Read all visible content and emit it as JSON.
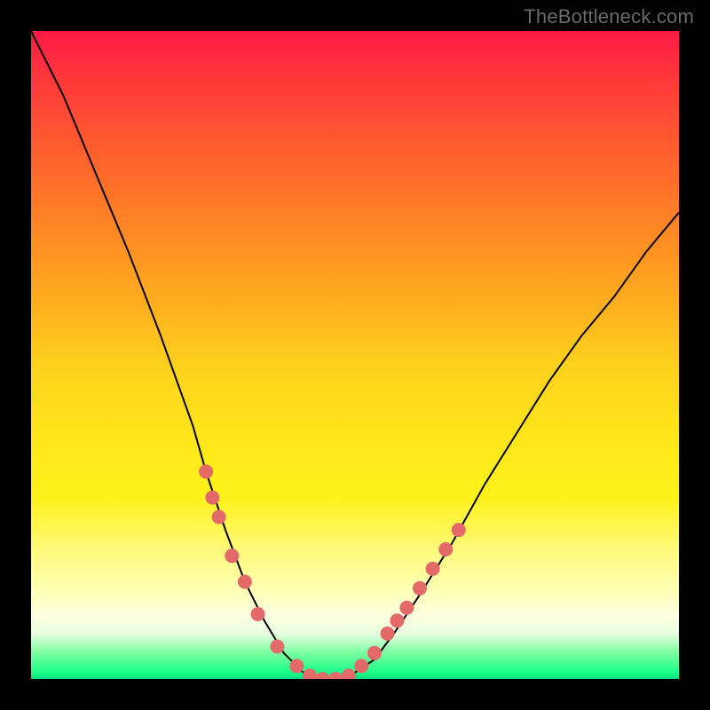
{
  "watermark": "TheBottleneck.com",
  "colors": {
    "black": "#000000",
    "dot": "#e46a6a",
    "gradient_top": "#ff1a44",
    "gradient_bottom": "#0bdf81"
  },
  "chart_data": {
    "type": "line",
    "title": "",
    "xlabel": "",
    "ylabel": "",
    "xlim": [
      0,
      100
    ],
    "ylim": [
      0,
      100
    ],
    "grid": false,
    "legend": false,
    "annotations": [
      "TheBottleneck.com"
    ],
    "series": [
      {
        "name": "bottleneck-curve",
        "x": [
          0,
          5,
          10,
          15,
          20,
          25,
          27,
          30,
          33,
          36,
          39,
          42,
          44,
          46,
          48,
          50,
          53,
          56,
          60,
          65,
          70,
          75,
          80,
          85,
          90,
          95,
          100
        ],
        "y": [
          100,
          90,
          78,
          66,
          53,
          39,
          32,
          23,
          15,
          9,
          4,
          1,
          0,
          0,
          0,
          1,
          3,
          7,
          13,
          21,
          30,
          38,
          46,
          53,
          59,
          66,
          72
        ]
      }
    ],
    "markers": [
      {
        "x": 27,
        "y": 32
      },
      {
        "x": 28,
        "y": 28
      },
      {
        "x": 29,
        "y": 25
      },
      {
        "x": 31,
        "y": 19
      },
      {
        "x": 33,
        "y": 15
      },
      {
        "x": 35,
        "y": 10
      },
      {
        "x": 38,
        "y": 5
      },
      {
        "x": 41,
        "y": 2
      },
      {
        "x": 43,
        "y": 0.5
      },
      {
        "x": 45,
        "y": 0
      },
      {
        "x": 47,
        "y": 0
      },
      {
        "x": 49,
        "y": 0.5
      },
      {
        "x": 51,
        "y": 2
      },
      {
        "x": 53,
        "y": 4
      },
      {
        "x": 55,
        "y": 7
      },
      {
        "x": 56.5,
        "y": 9
      },
      {
        "x": 58,
        "y": 11
      },
      {
        "x": 60,
        "y": 14
      },
      {
        "x": 62,
        "y": 17
      },
      {
        "x": 64,
        "y": 20
      },
      {
        "x": 66,
        "y": 23
      }
    ],
    "marker_radius_px": 8
  }
}
